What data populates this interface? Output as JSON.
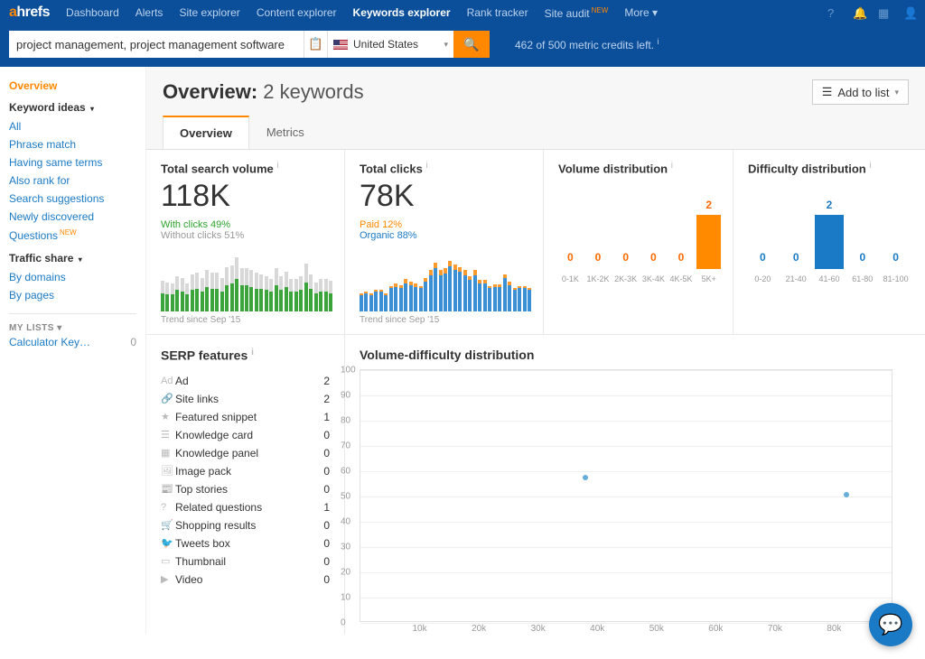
{
  "nav": {
    "logo_a": "a",
    "logo_rest": "hrefs",
    "links": [
      "Dashboard",
      "Alerts",
      "Site explorer",
      "Content explorer",
      "Keywords explorer",
      "Rank tracker",
      "Site audit",
      "More"
    ],
    "new_badge": "NEW",
    "active": 4
  },
  "search": {
    "value": "project management, project management software",
    "country": "United States",
    "credits": "462 of 500 metric credits left."
  },
  "sidebar": {
    "overview": "Overview",
    "keyword_ideas_title": "Keyword ideas",
    "keyword_ideas": [
      "All",
      "Phrase match",
      "Having same terms",
      "Also rank for",
      "Search suggestions",
      "Newly discovered",
      "Questions"
    ],
    "new_badge": "NEW",
    "traffic_share_title": "Traffic share",
    "traffic_share": [
      "By domains",
      "By pages"
    ],
    "mylists_title": "MY LISTS",
    "list_name": "Calculator Key…",
    "list_count": "0"
  },
  "header": {
    "title_bold": "Overview:",
    "title_rest": "2 keywords",
    "add_to_list": "Add to list"
  },
  "tabs": [
    "Overview",
    "Metrics"
  ],
  "cards": {
    "tsv": {
      "title": "Total search volume",
      "value": "118K",
      "with_clicks": "With clicks 49%",
      "without_clicks": "Without clicks 51%",
      "trend": "Trend since Sep '15"
    },
    "tc": {
      "title": "Total clicks",
      "value": "78K",
      "paid": "Paid 12%",
      "organic": "Organic 88%",
      "trend": "Trend since Sep '15"
    },
    "voldist": {
      "title": "Volume distribution"
    },
    "diffdist": {
      "title": "Difficulty distribution"
    }
  },
  "serp": {
    "title": "SERP features",
    "rows": [
      {
        "name": "Ad",
        "count": 2
      },
      {
        "name": "Site links",
        "count": 2
      },
      {
        "name": "Featured snippet",
        "count": 1
      },
      {
        "name": "Knowledge card",
        "count": 0
      },
      {
        "name": "Knowledge panel",
        "count": 0
      },
      {
        "name": "Image pack",
        "count": 0
      },
      {
        "name": "Top stories",
        "count": 0
      },
      {
        "name": "Related questions",
        "count": 1
      },
      {
        "name": "Shopping results",
        "count": 0
      },
      {
        "name": "Tweets box",
        "count": 0
      },
      {
        "name": "Thumbnail",
        "count": 0
      },
      {
        "name": "Video",
        "count": 0
      }
    ]
  },
  "scatter": {
    "title": "Volume-difficulty distribution"
  },
  "chart_data": [
    {
      "type": "bar",
      "id": "total_search_volume_trend",
      "title": "Total search volume trend since Sep '15",
      "xlabel": "month",
      "ylabel": "volume",
      "series": [
        {
          "name": "With clicks",
          "color": "#3ba53b",
          "values": [
            24,
            23,
            22,
            28,
            26,
            22,
            28,
            30,
            26,
            32,
            30,
            30,
            26,
            34,
            36,
            42,
            34,
            34,
            32,
            30,
            30,
            28,
            26,
            34,
            28,
            32,
            26,
            26,
            28,
            38,
            30,
            24,
            26,
            26,
            24
          ]
        },
        {
          "name": "Without clicks",
          "color": "#d8d8d8",
          "values": [
            16,
            15,
            14,
            18,
            18,
            14,
            20,
            20,
            18,
            22,
            20,
            20,
            18,
            24,
            24,
            28,
            22,
            22,
            22,
            20,
            18,
            18,
            16,
            22,
            18,
            20,
            16,
            16,
            18,
            24,
            18,
            14,
            16,
            16,
            16
          ]
        }
      ]
    },
    {
      "type": "bar",
      "id": "total_clicks_trend",
      "title": "Total clicks trend since Sep '15",
      "xlabel": "month",
      "ylabel": "clicks",
      "series": [
        {
          "name": "Organic",
          "color": "#3b8fd4",
          "values": [
            20,
            22,
            20,
            24,
            24,
            20,
            28,
            30,
            28,
            34,
            32,
            30,
            28,
            36,
            44,
            52,
            44,
            46,
            54,
            50,
            48,
            44,
            38,
            44,
            34,
            34,
            28,
            30,
            30,
            40,
            32,
            26,
            28,
            28,
            26
          ]
        },
        {
          "name": "Paid",
          "color": "#ff9a2e",
          "values": [
            2,
            2,
            2,
            2,
            2,
            2,
            3,
            4,
            4,
            5,
            4,
            4,
            3,
            5,
            6,
            7,
            6,
            6,
            7,
            7,
            6,
            6,
            5,
            6,
            4,
            4,
            3,
            3,
            3,
            5,
            4,
            3,
            3,
            3,
            3
          ]
        }
      ]
    },
    {
      "type": "bar",
      "id": "volume_distribution",
      "title": "Volume distribution",
      "categories": [
        "0-1K",
        "1K-2K",
        "2K-3K",
        "3K-4K",
        "4K-5K",
        "5K+"
      ],
      "values": [
        0,
        0,
        0,
        0,
        0,
        2
      ],
      "color": "#ff8a00"
    },
    {
      "type": "bar",
      "id": "difficulty_distribution",
      "title": "Difficulty distribution",
      "categories": [
        "0-20",
        "21-40",
        "41-60",
        "61-80",
        "81-100"
      ],
      "values": [
        0,
        0,
        2,
        0,
        0
      ],
      "color": "#1b7ac5"
    },
    {
      "type": "scatter",
      "id": "volume_difficulty_scatter",
      "title": "Volume-difficulty distribution",
      "xlabel": "volume",
      "ylabel": "difficulty",
      "xlim": [
        0,
        90000
      ],
      "ylim": [
        0,
        100
      ],
      "xticks": [
        10000,
        20000,
        30000,
        40000,
        50000,
        60000,
        70000,
        80000
      ],
      "xtick_labels": [
        "10k",
        "20k",
        "30k",
        "40k",
        "50k",
        "60k",
        "70k",
        "80k"
      ],
      "yticks": [
        0,
        10,
        20,
        30,
        40,
        50,
        60,
        70,
        80,
        90,
        100
      ],
      "points": [
        {
          "x": 38000,
          "y": 57
        },
        {
          "x": 82000,
          "y": 50
        }
      ]
    }
  ]
}
